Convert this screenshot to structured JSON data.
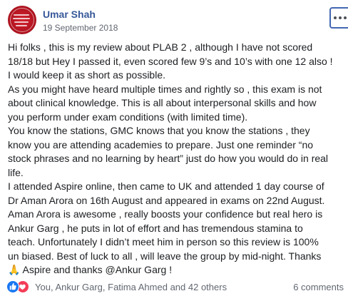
{
  "post": {
    "author": "Umar Shah",
    "date": "19 September 2018",
    "avatar_icon": "group-logo-avatar",
    "more_icon": "more-options-icon",
    "body_lines": [
      "Hi folks , this is my review about PLAB 2 , although I have not scored",
      "18/18 but Hey I passed it, even scored few 9’s and 10’s with one 12 also !",
      "I would keep it as short as possible.",
      "As you might have heard multiple times and rightly so , this exam is not",
      "about clinical knowledge. This is all about interpersonal skills and how",
      "you perform under exam conditions (with limited time).",
      "You know the stations, GMC knows that you know the stations , they",
      "know you are attending academies to prepare. Just one reminder “no",
      "stock phrases and no learning by heart” just do how you would do in real",
      "life.",
      "I attended Aspire online, then came to UK and attended 1 day course of",
      "Dr Aman Arora on 16th August and appeared in exams on 22nd August.",
      "Aman Arora is awesome , really boosts your confidence but real hero is",
      "Ankur Garg , he puts in lot of effort and has tremendous stamina to",
      "teach. Unfortunately I didn’t meet him in person so this review is 100%",
      "un biased. Best of luck to all , will leave the group by mid-night. Thanks",
      "🙏 Aspire and thanks @Ankur Garg !"
    ]
  },
  "footer": {
    "reactions": [
      "like-reaction-icon",
      "love-reaction-icon"
    ],
    "reactors_text": "You, Ankur Garg, Fatima Ahmed and 42 others",
    "comments_text": "6 comments"
  },
  "colors": {
    "author": "#365899",
    "meta": "#616770",
    "text": "#1c1e21",
    "like": "#1877f2",
    "love": "#f33e58",
    "avatar": "#c41a26"
  }
}
